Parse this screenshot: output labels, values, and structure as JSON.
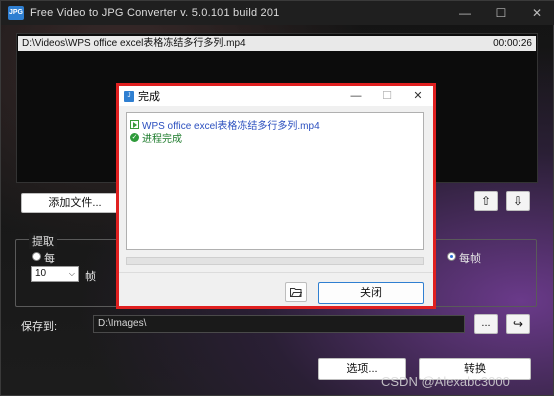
{
  "window": {
    "title": "Free Video to JPG Converter  v. 5.0.101 build 201",
    "icon_text": "JPG",
    "minimize_glyph": "—",
    "maximize_glyph": "☐",
    "close_glyph": "✕"
  },
  "file": {
    "path": "D:\\Videos\\WPS office excel表格冻结多行多列.mp4",
    "duration": "00:00:26"
  },
  "buttons": {
    "add_files": "添加文件...",
    "move_up_glyph": "⇧",
    "move_down_glyph": "⇩",
    "browse": "...",
    "open_folder_glyph": "↪",
    "options": "选项...",
    "convert": "转换"
  },
  "extract": {
    "group_label": "提取",
    "option_every": "每",
    "every_value": "10",
    "every_unit": "帧",
    "option_every_frame": "每帧",
    "selected": "every_frame"
  },
  "save": {
    "label": "保存到:",
    "path": "D:\\Images\\"
  },
  "dialog": {
    "title": "完成",
    "log": [
      {
        "type": "file",
        "text": "WPS office excel表格冻结多行多列.mp4"
      },
      {
        "type": "status",
        "text": "进程完成"
      }
    ],
    "progress": 0,
    "open_folder_glyph": "⌂",
    "close_label": "关闭",
    "minimize_glyph": "—",
    "maximize_glyph": "☐",
    "close_glyph": "✕"
  },
  "watermark": "CSDN @Alexabc3000",
  "colors": {
    "dialog_border": "#e02020",
    "progress": "#06b025",
    "file_text": "#2b4fbf",
    "status_text": "#1b7a2a"
  }
}
